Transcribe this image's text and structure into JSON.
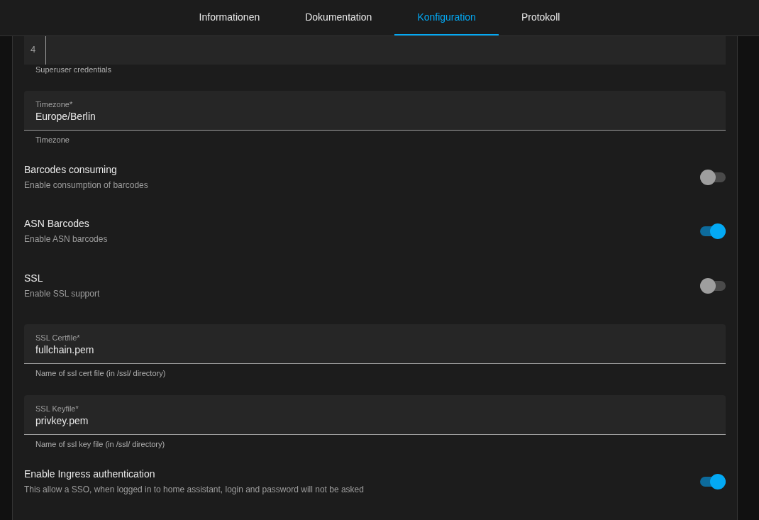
{
  "tabs": [
    {
      "label": "Informationen",
      "selected": false
    },
    {
      "label": "Dokumentation",
      "selected": false
    },
    {
      "label": "Konfiguration",
      "selected": true
    },
    {
      "label": "Protokoll",
      "selected": false
    }
  ],
  "items": [
    {
      "kind": "code",
      "line_number": "4",
      "helper": "Superuser credentials"
    },
    {
      "kind": "text",
      "label": "Timezone*",
      "value": "Europe/Berlin",
      "helper": "Timezone"
    },
    {
      "kind": "toggle",
      "title": "Barcodes consuming",
      "description": "Enable consumption of barcodes",
      "on": false
    },
    {
      "kind": "toggle",
      "title": "ASN Barcodes",
      "description": "Enable ASN barcodes",
      "on": true
    },
    {
      "kind": "toggle",
      "title": "SSL",
      "description": "Enable SSL support",
      "on": false
    },
    {
      "kind": "text",
      "label": "SSL Certfile*",
      "value": "fullchain.pem",
      "helper": "Name of ssl cert file (in /ssl/ directory)"
    },
    {
      "kind": "text",
      "label": "SSL Keyfile*",
      "value": "privkey.pem",
      "helper": "Name of ssl key file (in /ssl/ directory)"
    },
    {
      "kind": "toggle",
      "title": "Enable Ingress authentication",
      "description": "This allow a SSO, when logged in to home assistant, login and password will not be asked",
      "on": true
    }
  ]
}
